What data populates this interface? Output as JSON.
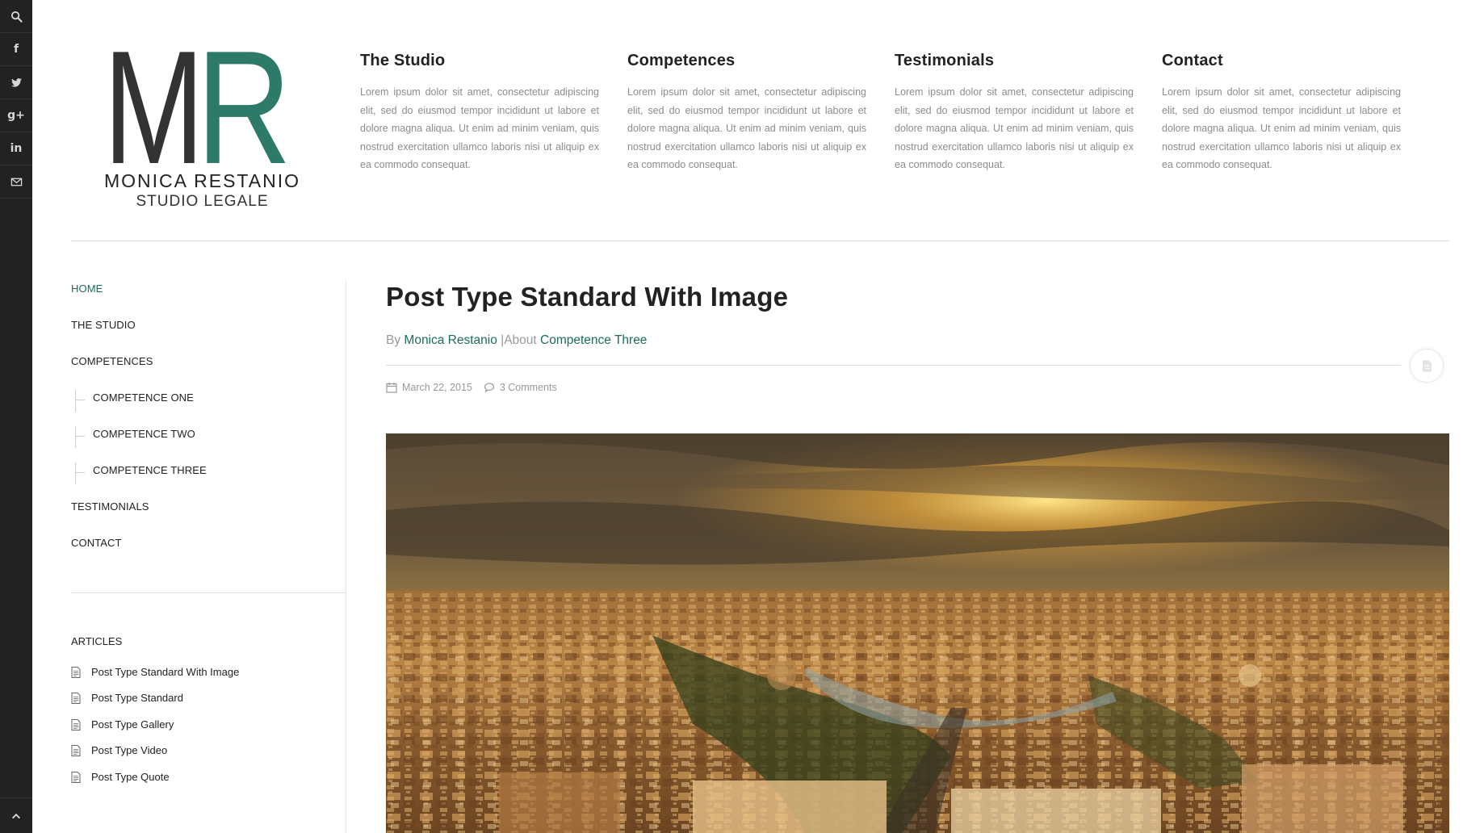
{
  "social": {
    "items": [
      {
        "name": "search-icon"
      },
      {
        "name": "facebook-icon",
        "glyph": "f"
      },
      {
        "name": "twitter-icon"
      },
      {
        "name": "google-plus-icon",
        "glyph": "g+"
      },
      {
        "name": "linkedin-icon",
        "glyph": "in"
      },
      {
        "name": "mail-icon"
      }
    ],
    "scroll_top_icon": "chevron-up-icon"
  },
  "logo": {
    "letter_m": "M",
    "letter_r": "R",
    "name": "MONICA RESTANIO",
    "subtitle": "STUDIO LEGALE",
    "colors": {
      "m": "#333333",
      "r": "#2e7a68"
    }
  },
  "header_columns": [
    {
      "title": "The Studio",
      "text": "Lorem ipsum dolor sit amet, consectetur adipiscing elit, sed do eiusmod tempor incididunt ut labore et dolore magna aliqua. Ut enim ad minim veniam, quis nostrud exercitation ullamco laboris nisi ut aliquip ex ea commodo consequat."
    },
    {
      "title": "Competences",
      "text": "Lorem ipsum dolor sit amet, consectetur adipiscing elit, sed do eiusmod tempor incididunt ut labore et dolore magna aliqua. Ut enim ad minim veniam, quis nostrud exercitation ullamco laboris nisi ut aliquip ex ea commodo consequat."
    },
    {
      "title": "Testimonials",
      "text": "Lorem ipsum dolor sit amet, consectetur adipiscing elit, sed do eiusmod tempor incididunt ut labore et dolore magna aliqua. Ut enim ad minim veniam, quis nostrud exercitation ullamco laboris nisi ut aliquip ex ea commodo consequat."
    },
    {
      "title": "Contact",
      "text": "Lorem ipsum dolor sit amet, consectetur adipiscing elit, sed do eiusmod tempor incididunt ut labore et dolore magna aliqua. Ut enim ad minim veniam, quis nostrud exercitation ullamco laboris nisi ut aliquip ex ea commodo consequat."
    }
  ],
  "nav": {
    "items": [
      {
        "label": "HOME",
        "active": true
      },
      {
        "label": "THE STUDIO"
      },
      {
        "label": "COMPETENCES"
      },
      {
        "label": "COMPETENCE ONE",
        "sub": true
      },
      {
        "label": "COMPETENCE TWO",
        "sub": true
      },
      {
        "label": "COMPETENCE THREE",
        "sub": true
      },
      {
        "label": "TESTIMONIALS"
      },
      {
        "label": "CONTACT"
      }
    ],
    "accent": "#1d6b5c"
  },
  "articles": {
    "title": "ARTICLES",
    "items": [
      "Post Type Standard With Image",
      "Post Type Standard",
      "Post Type Gallery",
      "Post Type Video",
      "Post Type Quote"
    ]
  },
  "post": {
    "title": "Post Type Standard With Image",
    "by_label": "By",
    "author": "Monica Restanio",
    "separator": "|",
    "about_label": "About",
    "category": "Competence Three",
    "date": "March 22, 2015",
    "comments": "3 Comments",
    "format_icon": "document-icon"
  }
}
